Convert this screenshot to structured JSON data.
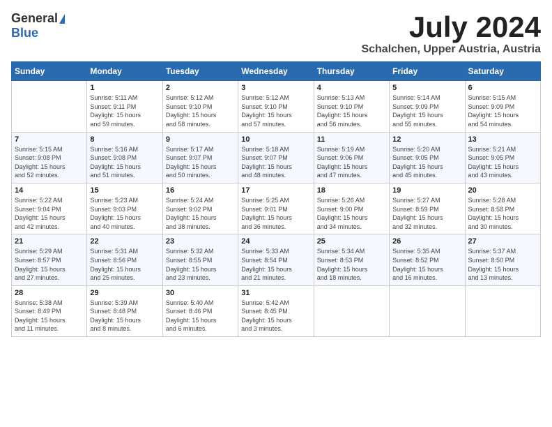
{
  "header": {
    "logo_general": "General",
    "logo_blue": "Blue",
    "title_month": "July 2024",
    "title_location": "Schalchen, Upper Austria, Austria"
  },
  "weekdays": [
    "Sunday",
    "Monday",
    "Tuesday",
    "Wednesday",
    "Thursday",
    "Friday",
    "Saturday"
  ],
  "weeks": [
    [
      {
        "day": "",
        "info": ""
      },
      {
        "day": "1",
        "info": "Sunrise: 5:11 AM\nSunset: 9:11 PM\nDaylight: 15 hours\nand 59 minutes."
      },
      {
        "day": "2",
        "info": "Sunrise: 5:12 AM\nSunset: 9:10 PM\nDaylight: 15 hours\nand 58 minutes."
      },
      {
        "day": "3",
        "info": "Sunrise: 5:12 AM\nSunset: 9:10 PM\nDaylight: 15 hours\nand 57 minutes."
      },
      {
        "day": "4",
        "info": "Sunrise: 5:13 AM\nSunset: 9:10 PM\nDaylight: 15 hours\nand 56 minutes."
      },
      {
        "day": "5",
        "info": "Sunrise: 5:14 AM\nSunset: 9:09 PM\nDaylight: 15 hours\nand 55 minutes."
      },
      {
        "day": "6",
        "info": "Sunrise: 5:15 AM\nSunset: 9:09 PM\nDaylight: 15 hours\nand 54 minutes."
      }
    ],
    [
      {
        "day": "7",
        "info": "Sunrise: 5:15 AM\nSunset: 9:08 PM\nDaylight: 15 hours\nand 52 minutes."
      },
      {
        "day": "8",
        "info": "Sunrise: 5:16 AM\nSunset: 9:08 PM\nDaylight: 15 hours\nand 51 minutes."
      },
      {
        "day": "9",
        "info": "Sunrise: 5:17 AM\nSunset: 9:07 PM\nDaylight: 15 hours\nand 50 minutes."
      },
      {
        "day": "10",
        "info": "Sunrise: 5:18 AM\nSunset: 9:07 PM\nDaylight: 15 hours\nand 48 minutes."
      },
      {
        "day": "11",
        "info": "Sunrise: 5:19 AM\nSunset: 9:06 PM\nDaylight: 15 hours\nand 47 minutes."
      },
      {
        "day": "12",
        "info": "Sunrise: 5:20 AM\nSunset: 9:05 PM\nDaylight: 15 hours\nand 45 minutes."
      },
      {
        "day": "13",
        "info": "Sunrise: 5:21 AM\nSunset: 9:05 PM\nDaylight: 15 hours\nand 43 minutes."
      }
    ],
    [
      {
        "day": "14",
        "info": "Sunrise: 5:22 AM\nSunset: 9:04 PM\nDaylight: 15 hours\nand 42 minutes."
      },
      {
        "day": "15",
        "info": "Sunrise: 5:23 AM\nSunset: 9:03 PM\nDaylight: 15 hours\nand 40 minutes."
      },
      {
        "day": "16",
        "info": "Sunrise: 5:24 AM\nSunset: 9:02 PM\nDaylight: 15 hours\nand 38 minutes."
      },
      {
        "day": "17",
        "info": "Sunrise: 5:25 AM\nSunset: 9:01 PM\nDaylight: 15 hours\nand 36 minutes."
      },
      {
        "day": "18",
        "info": "Sunrise: 5:26 AM\nSunset: 9:00 PM\nDaylight: 15 hours\nand 34 minutes."
      },
      {
        "day": "19",
        "info": "Sunrise: 5:27 AM\nSunset: 8:59 PM\nDaylight: 15 hours\nand 32 minutes."
      },
      {
        "day": "20",
        "info": "Sunrise: 5:28 AM\nSunset: 8:58 PM\nDaylight: 15 hours\nand 30 minutes."
      }
    ],
    [
      {
        "day": "21",
        "info": "Sunrise: 5:29 AM\nSunset: 8:57 PM\nDaylight: 15 hours\nand 27 minutes."
      },
      {
        "day": "22",
        "info": "Sunrise: 5:31 AM\nSunset: 8:56 PM\nDaylight: 15 hours\nand 25 minutes."
      },
      {
        "day": "23",
        "info": "Sunrise: 5:32 AM\nSunset: 8:55 PM\nDaylight: 15 hours\nand 23 minutes."
      },
      {
        "day": "24",
        "info": "Sunrise: 5:33 AM\nSunset: 8:54 PM\nDaylight: 15 hours\nand 21 minutes."
      },
      {
        "day": "25",
        "info": "Sunrise: 5:34 AM\nSunset: 8:53 PM\nDaylight: 15 hours\nand 18 minutes."
      },
      {
        "day": "26",
        "info": "Sunrise: 5:35 AM\nSunset: 8:52 PM\nDaylight: 15 hours\nand 16 minutes."
      },
      {
        "day": "27",
        "info": "Sunrise: 5:37 AM\nSunset: 8:50 PM\nDaylight: 15 hours\nand 13 minutes."
      }
    ],
    [
      {
        "day": "28",
        "info": "Sunrise: 5:38 AM\nSunset: 8:49 PM\nDaylight: 15 hours\nand 11 minutes."
      },
      {
        "day": "29",
        "info": "Sunrise: 5:39 AM\nSunset: 8:48 PM\nDaylight: 15 hours\nand 8 minutes."
      },
      {
        "day": "30",
        "info": "Sunrise: 5:40 AM\nSunset: 8:46 PM\nDaylight: 15 hours\nand 6 minutes."
      },
      {
        "day": "31",
        "info": "Sunrise: 5:42 AM\nSunset: 8:45 PM\nDaylight: 15 hours\nand 3 minutes."
      },
      {
        "day": "",
        "info": ""
      },
      {
        "day": "",
        "info": ""
      },
      {
        "day": "",
        "info": ""
      }
    ]
  ]
}
